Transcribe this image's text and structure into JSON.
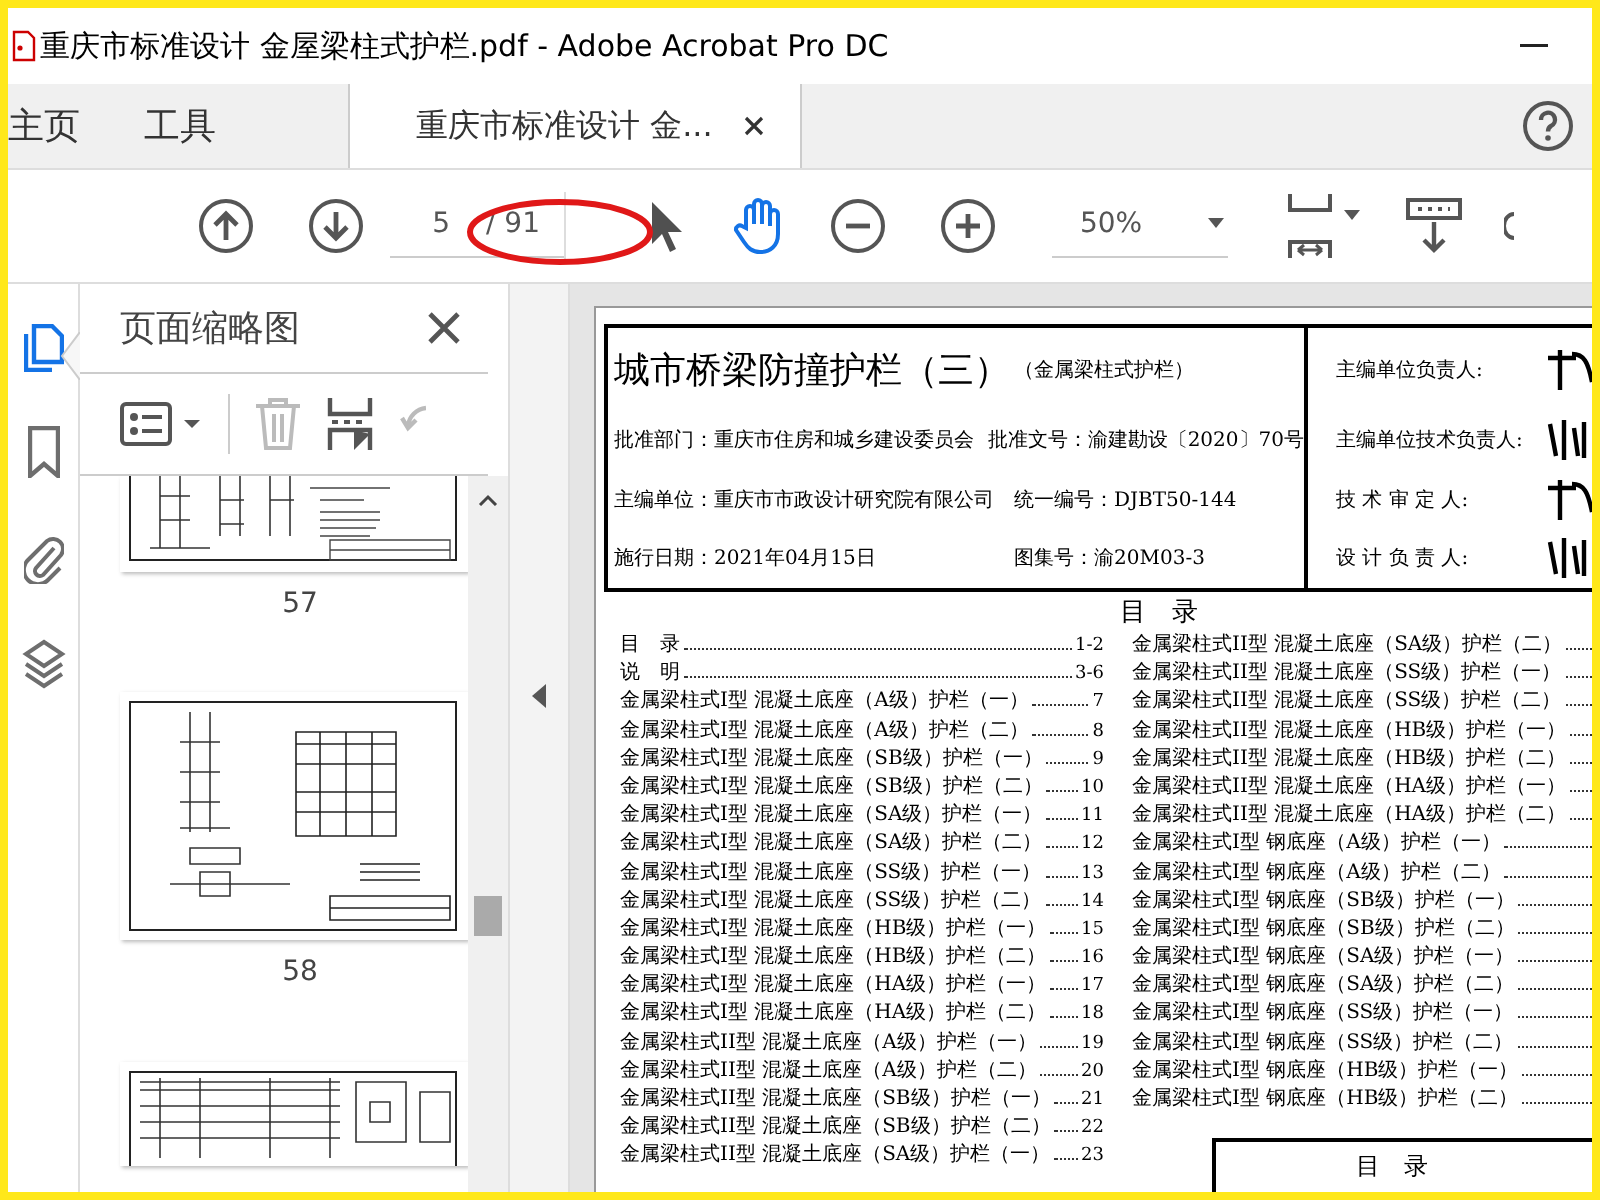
{
  "title_bar": {
    "title": "重庆市标准设计 金屋梁柱式护栏.pdf - Adobe Acrobat Pro DC"
  },
  "tabs": [
    {
      "label": "主页",
      "kind": "nav",
      "selected": false
    },
    {
      "label": "工具",
      "kind": "nav",
      "selected": false
    },
    {
      "label": "重庆市标准设计 金...",
      "kind": "document",
      "selected": true
    }
  ],
  "toolbar": {
    "page_number": "5",
    "page_total": "/ 91",
    "zoom": "50%",
    "tools": [
      {
        "kind": "select",
        "selected": false
      },
      {
        "kind": "hand",
        "selected": true
      }
    ]
  },
  "side_rail": [
    {
      "kind": "thumbnails",
      "selected": true
    },
    {
      "kind": "bookmarks",
      "selected": false
    },
    {
      "kind": "attachments",
      "selected": false
    },
    {
      "kind": "layers",
      "selected": false
    }
  ],
  "thumbnail_panel": {
    "title": "页面缩略图",
    "thumbnails": [
      {
        "label": "57",
        "kind": "cut-top"
      },
      {
        "label": "58",
        "kind": "full"
      }
    ]
  },
  "document": {
    "title": "城市桥梁防撞护栏（三）",
    "subtitle": "（金属梁柱式护栏）",
    "info_rows": [
      [
        "批准部门：重庆市住房和城乡建设委员会",
        "批准文号：渝建勘设〔2020〕70号"
      ],
      [
        "主编单位：重庆市市政设计研究院有限公司",
        "统一编号：DJBT50-144"
      ],
      [
        "施行日期：2021年04月15日",
        "图集号：渝20M03-3"
      ]
    ],
    "signers": [
      "主编单位负责人:",
      "主编单位技术负责人:",
      "技 术 审 定 人:",
      "设 计 负 责 人:"
    ],
    "toc_heading": "目　录",
    "toc_left": [
      {
        "text": "目　录",
        "page": "1-2"
      },
      {
        "text": "说　明",
        "page": "3-6"
      },
      {
        "text": "金属梁柱式I型 混凝土底座（A级）护栏（一）",
        "page": "7"
      },
      {
        "text": "金属梁柱式I型 混凝土底座（A级）护栏（二）",
        "page": "8"
      },
      {
        "text": "金属梁柱式I型 混凝土底座（SB级）护栏（一）",
        "page": "9"
      },
      {
        "text": "金属梁柱式I型 混凝土底座（SB级）护栏（二）",
        "page": "10"
      },
      {
        "text": "金属梁柱式I型 混凝土底座（SA级）护栏（一）",
        "page": "11"
      },
      {
        "text": "金属梁柱式I型 混凝土底座（SA级）护栏（二）",
        "page": "12"
      },
      {
        "text": "金属梁柱式I型 混凝土底座（SS级）护栏（一）",
        "page": "13"
      },
      {
        "text": "金属梁柱式I型 混凝土底座（SS级）护栏（二）",
        "page": "14"
      },
      {
        "text": "金属梁柱式I型 混凝土底座（HB级）护栏（一）",
        "page": "15"
      },
      {
        "text": "金属梁柱式I型 混凝土底座（HB级）护栏（二）",
        "page": "16"
      },
      {
        "text": "金属梁柱式I型 混凝土底座（HA级）护栏（一）",
        "page": "17"
      },
      {
        "text": "金属梁柱式I型 混凝土底座（HA级）护栏（二）",
        "page": "18"
      },
      {
        "text": "金属梁柱式II型 混凝土底座（A级）护栏（一）",
        "page": "19"
      },
      {
        "text": "金属梁柱式II型 混凝土底座（A级）护栏（二）",
        "page": "20"
      },
      {
        "text": "金属梁柱式II型 混凝土底座（SB级）护栏（一）",
        "page": "21"
      },
      {
        "text": "金属梁柱式II型 混凝土底座（SB级）护栏（二）",
        "page": "22"
      },
      {
        "text": "金属梁柱式II型 混凝土底座（SA级）护栏（一）",
        "page": "23"
      }
    ],
    "toc_right": [
      "金属梁柱式II型 混凝土底座（SA级）护栏（二）",
      "金属梁柱式II型 混凝土底座（SS级）护栏（一）",
      "金属梁柱式II型 混凝土底座（SS级）护栏（二）",
      "金属梁柱式II型 混凝土底座（HB级）护栏（一）",
      "金属梁柱式II型 混凝土底座（HB级）护栏（二）",
      "金属梁柱式II型 混凝土底座（HA级）护栏（一）",
      "金属梁柱式II型 混凝土底座（HA级）护栏（二）",
      "金属梁柱式I型 钢底座（A级）护栏（一）",
      "金属梁柱式I型 钢底座（A级）护栏（二）",
      "金属梁柱式I型 钢底座（SB级）护栏（一）",
      "金属梁柱式I型 钢底座（SB级）护栏（二）",
      "金属梁柱式I型 钢底座（SA级）护栏（一）",
      "金属梁柱式I型 钢底座（SA级）护栏（二）",
      "金属梁柱式I型 钢底座（SS级）护栏（一）",
      "金属梁柱式I型 钢底座（SS级）护栏（二）",
      "金属梁柱式I型 钢底座（HB级）护栏（一）",
      "金属梁柱式I型 钢底座（HB级）护栏（二）"
    ],
    "title_block_label": "目　录"
  }
}
